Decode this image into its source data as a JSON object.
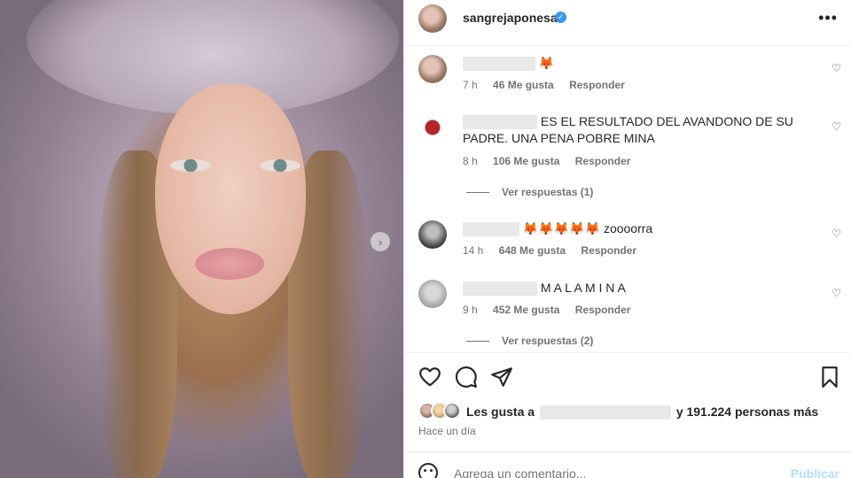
{
  "post": {
    "username": "sangrejaponesa",
    "verified": true,
    "more_icon": "more-horizontal-icon"
  },
  "comments": [
    {
      "text_suffix": "🦊",
      "time": "7 h",
      "likes": "46 Me gusta",
      "reply": "Responder"
    },
    {
      "text": "ES EL RESULTADO DEL AVANDONO DE SU PADRE. UNA PENA POBRE MINA",
      "time": "8 h",
      "likes": "106 Me gusta",
      "reply": "Responder",
      "view_replies": "Ver respuestas (1)"
    },
    {
      "text_suffix": "🦊🦊🦊🦊🦊 zoooorra",
      "time": "14 h",
      "likes": "648 Me gusta",
      "reply": "Responder"
    },
    {
      "text": "M A L A M I N A",
      "time": "9 h",
      "likes": "452 Me gusta",
      "reply": "Responder",
      "view_replies": "Ver respuestas (2)"
    }
  ],
  "likes": {
    "prefix": "Les gusta a",
    "suffix": "y 191.224 personas más"
  },
  "time_ago": "Hace un día",
  "add_comment": {
    "placeholder": "Agrega un comentario...",
    "post_label": "Publicar"
  },
  "colors": {
    "verified": "#3897f0",
    "post_button": "#b2dffc",
    "secondary_text": "#737373"
  }
}
